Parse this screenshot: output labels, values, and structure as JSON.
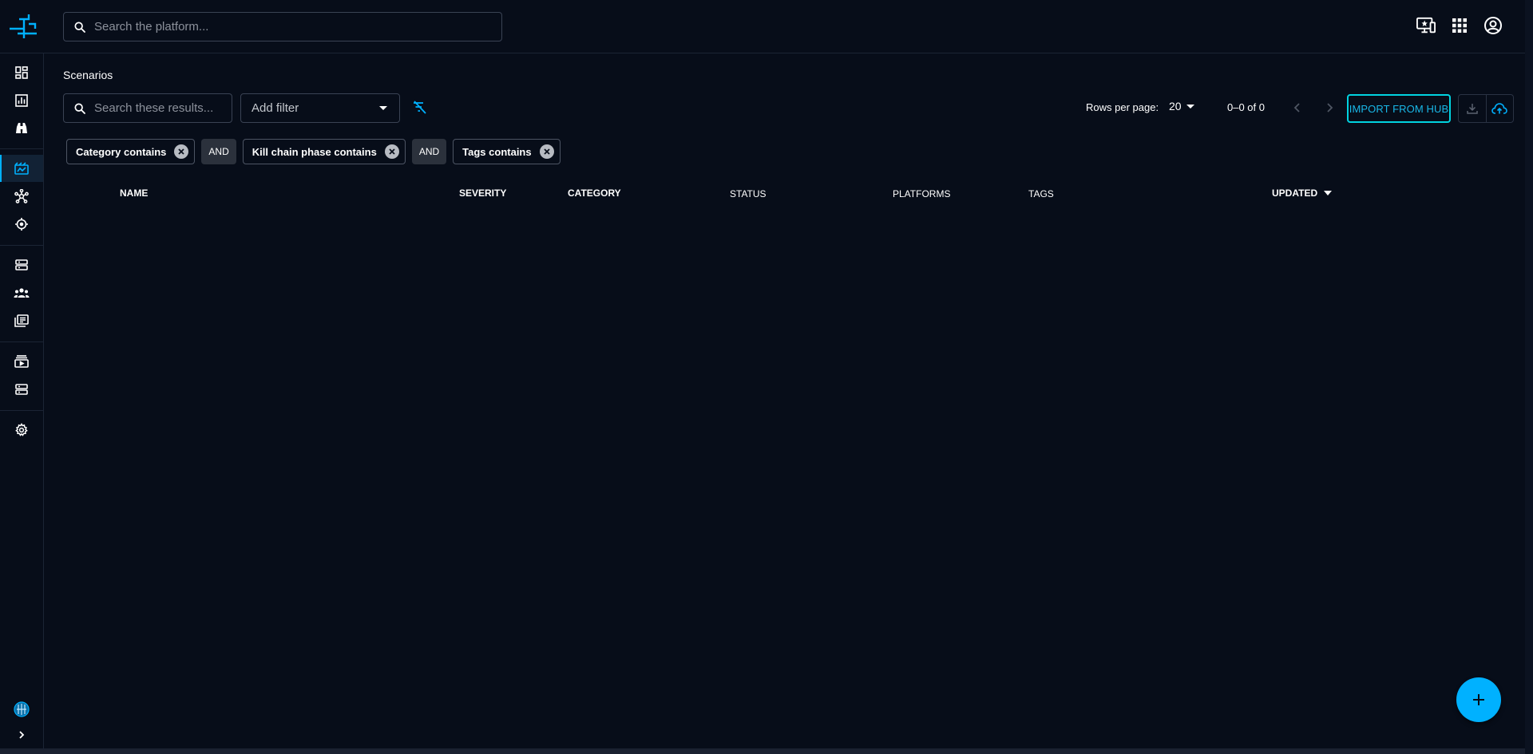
{
  "topbar": {
    "search_placeholder": "Search the platform...",
    "icons": [
      "monitor-star-icon",
      "apps-grid-icon",
      "account-circle-icon"
    ]
  },
  "leftnav": {
    "items": [
      {
        "icon": "dashboard-icon",
        "active": false
      },
      {
        "icon": "analytics-chart-icon",
        "active": false
      },
      {
        "icon": "binoculars-icon",
        "active": false
      },
      {
        "icon": "scenarios-icon",
        "active": true
      },
      {
        "icon": "network-nodes-icon",
        "active": false
      },
      {
        "icon": "target-icon",
        "active": false
      },
      {
        "icon": "server-stack-icon",
        "active": false
      },
      {
        "icon": "teams-icon",
        "active": false
      },
      {
        "icon": "library-icon",
        "active": false
      },
      {
        "icon": "media-collection-icon",
        "active": false
      },
      {
        "icon": "integrations-icon",
        "active": false
      },
      {
        "icon": "settings-gear-icon",
        "active": false
      }
    ],
    "bottom": [
      "filigran-icon",
      "expand-chevron-icon"
    ]
  },
  "page": {
    "title": "Scenarios",
    "search_placeholder": "Search these results...",
    "add_filter_label": "Add filter",
    "rows_per_page_label": "Rows per page:",
    "rows_per_page_value": "20",
    "pagination_info": "0–0 of 0",
    "import_button": "IMPORT FROM HUB"
  },
  "filters": {
    "chips": [
      {
        "label": "Category contains"
      },
      {
        "label": "Kill chain phase contains"
      },
      {
        "label": "Tags contains"
      }
    ],
    "operator": "AND"
  },
  "table": {
    "columns": {
      "name": "NAME",
      "severity": "SEVERITY",
      "category": "CATEGORY",
      "status": "STATUS",
      "platforms": "PLATFORMS",
      "tags": "TAGS",
      "updated": "UPDATED"
    },
    "rows": []
  },
  "colors": {
    "background": "#070d19",
    "accent": "#00b1ff",
    "import_border": "#00d3e0"
  }
}
